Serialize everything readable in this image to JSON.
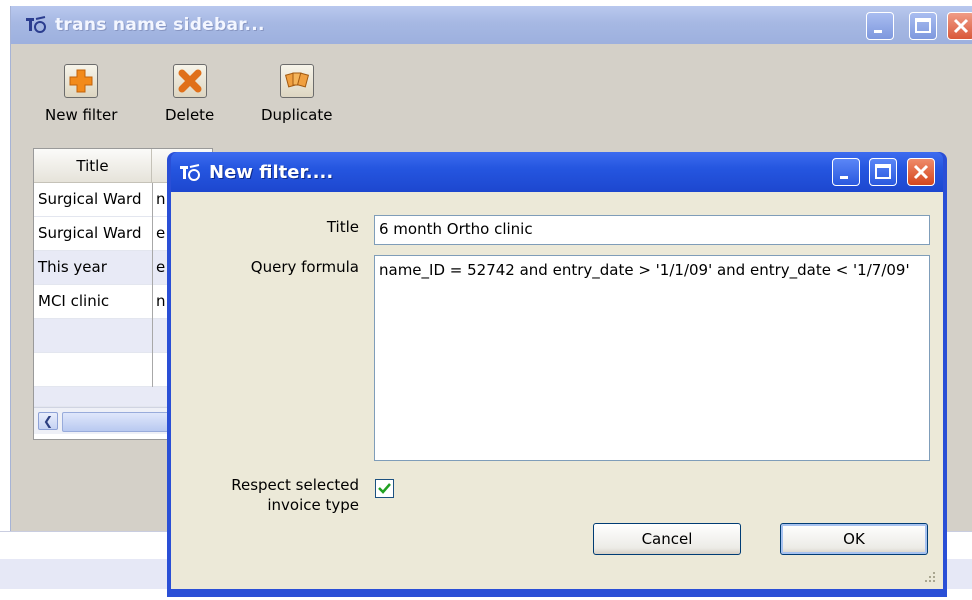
{
  "main_window": {
    "title": "trans name sidebar...",
    "toolbar": [
      {
        "label": "New filter",
        "icon": "plus-icon"
      },
      {
        "label": "Delete",
        "icon": "delete-x-icon"
      },
      {
        "label": "Duplicate",
        "icon": "duplicate-icon"
      }
    ],
    "list": {
      "column_title": "Title",
      "rows": [
        {
          "title": "Surgical Ward",
          "second": "n"
        },
        {
          "title": "Surgical Ward",
          "second": "e"
        },
        {
          "title": "This year",
          "second": "e"
        },
        {
          "title": "MCI clinic",
          "second": "n"
        }
      ]
    }
  },
  "dialog": {
    "title": "New filter....",
    "title_label": "Title",
    "title_value": "6 month Ortho clinic",
    "query_label": "Query formula",
    "query_value": "name_ID = 52742 and entry_date > '1/1/09' and entry_date < '1/7/09'",
    "respect_label_line1": "Respect  selected",
    "respect_label_line2": "invoice type",
    "respect_checked": true,
    "cancel_label": "Cancel",
    "ok_label": "OK"
  },
  "colors": {
    "dialog_frame": "#2a4fd6",
    "main_title_bar": "#a6b8e3",
    "close_button": "#d9583a"
  }
}
